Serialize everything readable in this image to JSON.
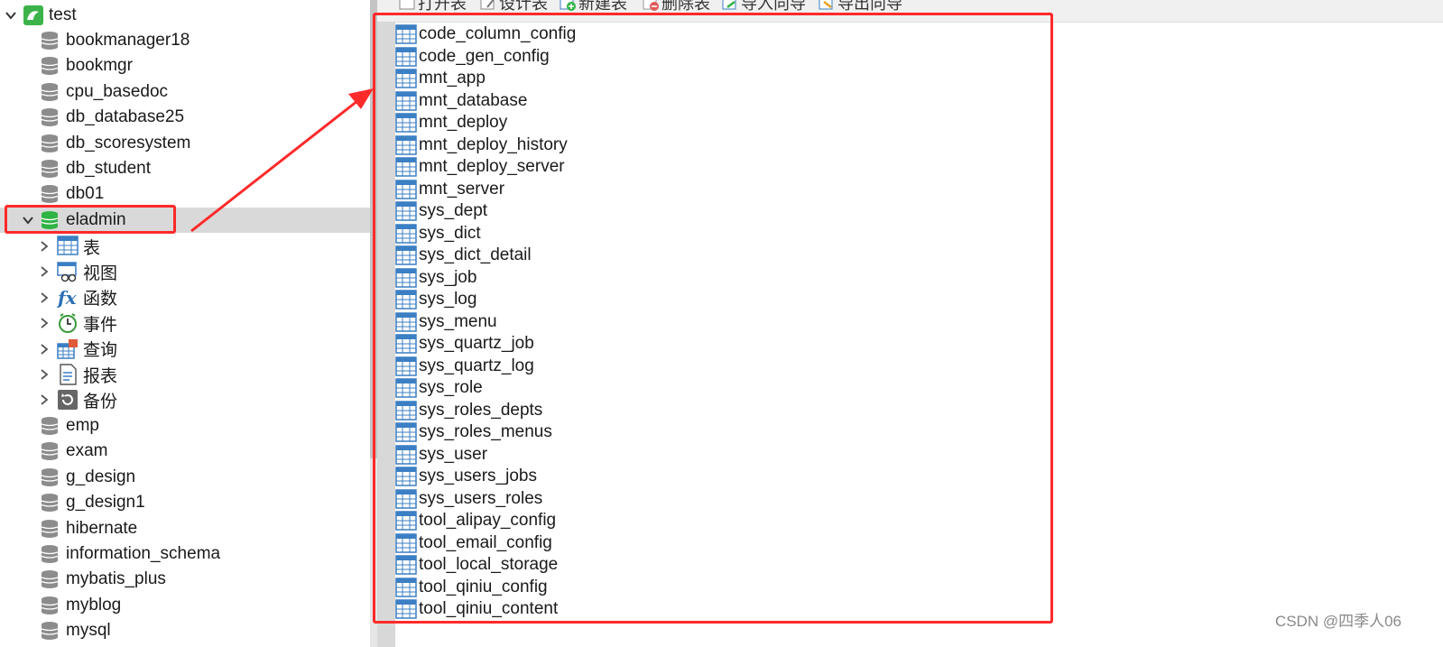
{
  "tree": {
    "connection": {
      "label": "test"
    },
    "databases_before": [
      {
        "label": "bookmanager18"
      },
      {
        "label": "bookmgr"
      },
      {
        "label": "cpu_basedoc"
      },
      {
        "label": "db_database25"
      },
      {
        "label": "db_scoresystem"
      },
      {
        "label": "db_student"
      },
      {
        "label": "db01"
      }
    ],
    "selected_database": {
      "label": "eladmin"
    },
    "object_groups": [
      {
        "label": "表",
        "icon": "table-icon"
      },
      {
        "label": "视图",
        "icon": "view-icon"
      },
      {
        "label": "函数",
        "icon": "function-icon"
      },
      {
        "label": "事件",
        "icon": "event-icon"
      },
      {
        "label": "查询",
        "icon": "query-icon"
      },
      {
        "label": "报表",
        "icon": "report-icon"
      },
      {
        "label": "备份",
        "icon": "backup-icon"
      }
    ],
    "databases_after": [
      {
        "label": "emp"
      },
      {
        "label": "exam"
      },
      {
        "label": "g_design"
      },
      {
        "label": "g_design1"
      },
      {
        "label": "hibernate"
      },
      {
        "label": "information_schema"
      },
      {
        "label": "mybatis_plus"
      },
      {
        "label": "myblog"
      },
      {
        "label": "mysql"
      }
    ]
  },
  "toolbar": [
    {
      "label": "打开表",
      "icon": "open-table-icon"
    },
    {
      "label": "设计表",
      "icon": "design-table-icon"
    },
    {
      "label": "新建表",
      "icon": "new-table-icon"
    },
    {
      "label": "删除表",
      "icon": "delete-table-icon"
    },
    {
      "label": "导入向导",
      "icon": "import-wizard-icon"
    },
    {
      "label": "导出向导",
      "icon": "export-wizard-icon"
    }
  ],
  "tables": [
    {
      "name": "code_column_config"
    },
    {
      "name": "code_gen_config"
    },
    {
      "name": "mnt_app"
    },
    {
      "name": "mnt_database"
    },
    {
      "name": "mnt_deploy"
    },
    {
      "name": "mnt_deploy_history"
    },
    {
      "name": "mnt_deploy_server"
    },
    {
      "name": "mnt_server"
    },
    {
      "name": "sys_dept"
    },
    {
      "name": "sys_dict"
    },
    {
      "name": "sys_dict_detail"
    },
    {
      "name": "sys_job"
    },
    {
      "name": "sys_log"
    },
    {
      "name": "sys_menu"
    },
    {
      "name": "sys_quartz_job"
    },
    {
      "name": "sys_quartz_log"
    },
    {
      "name": "sys_role"
    },
    {
      "name": "sys_roles_depts"
    },
    {
      "name": "sys_roles_menus"
    },
    {
      "name": "sys_user"
    },
    {
      "name": "sys_users_jobs"
    },
    {
      "name": "sys_users_roles"
    },
    {
      "name": "tool_alipay_config"
    },
    {
      "name": "tool_email_config"
    },
    {
      "name": "tool_local_storage"
    },
    {
      "name": "tool_qiniu_config"
    },
    {
      "name": "tool_qiniu_content"
    }
  ],
  "watermark": "CSDN @四季人06",
  "colors": {
    "highlight": "#ff2a2a",
    "selected_row": "#d9d9d9",
    "database_icon": "#8c8c8c",
    "active_database_icon": "#2fb344",
    "table_icon": "#3b7fc4"
  }
}
